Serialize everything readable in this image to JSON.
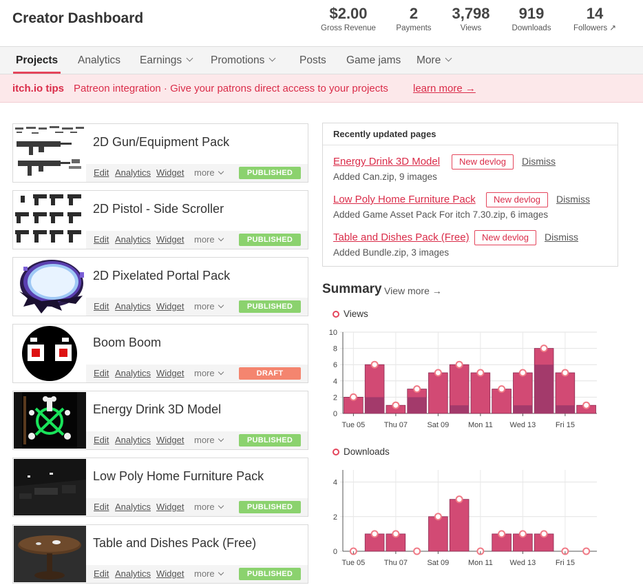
{
  "header": {
    "title": "Creator Dashboard",
    "stats": [
      {
        "value": "$2.00",
        "label": "Gross Revenue"
      },
      {
        "value": "2",
        "label": "Payments"
      },
      {
        "value": "3,798",
        "label": "Views"
      },
      {
        "value": "919",
        "label": "Downloads"
      },
      {
        "value": "14",
        "label": "Followers ↗"
      }
    ]
  },
  "nav": {
    "projects": "Projects",
    "analytics": "Analytics",
    "earnings": "Earnings",
    "promotions": "Promotions",
    "posts": "Posts",
    "game_jams": "Game jams",
    "more": "More"
  },
  "tips": {
    "label": "itch.io tips",
    "text": "Patreon integration · Give your patrons direct access to your projects",
    "link": "learn more →"
  },
  "project_actions": {
    "edit": "Edit",
    "analytics": "Analytics",
    "widget": "Widget",
    "more": "more"
  },
  "projects": [
    {
      "name": "2D Gun/Equipment Pack",
      "status": "PUBLISHED"
    },
    {
      "name": "2D Pistol - Side Scroller",
      "status": "PUBLISHED"
    },
    {
      "name": "2D Pixelated Portal Pack",
      "status": "PUBLISHED"
    },
    {
      "name": "Boom Boom",
      "status": "DRAFT"
    },
    {
      "name": "Energy Drink 3D Model",
      "status": "PUBLISHED"
    },
    {
      "name": "Low Poly Home Furniture Pack",
      "status": "PUBLISHED"
    },
    {
      "name": "Table and Dishes Pack (Free)",
      "status": "PUBLISHED"
    }
  ],
  "recent": {
    "heading": "Recently updated pages",
    "new_devlog": "New devlog",
    "dismiss": "Dismiss",
    "items": [
      {
        "title": "Energy Drink 3D Model",
        "desc": "Added Can.zip, 9 images"
      },
      {
        "title": "Low Poly Home Furniture Pack",
        "desc": "Added Game Asset Pack For itch 7.30.zip, 6 images"
      },
      {
        "title": "Table and Dishes Pack (Free)",
        "desc": "Added Bundle.zip, 3 images"
      }
    ]
  },
  "summary": {
    "title": "Summary",
    "view_more": "View more →"
  },
  "colors": {
    "accent": "#da2c49",
    "bar": "#d24a74",
    "bar_dark": "#a33a6b",
    "published": "#8bd26e",
    "draft": "#f4856f"
  },
  "chart_data": [
    {
      "type": "bar",
      "title": "Views",
      "x": [
        "Tue 05",
        "Wed 06",
        "Thu 07",
        "Fri 08",
        "Sat 09",
        "Sun 10",
        "Mon 11",
        "Tue 12",
        "Wed 13",
        "Thu 14",
        "Fri 15",
        "Sat 16"
      ],
      "tick_labels": [
        "Tue 05",
        "Thu 07",
        "Sat 09",
        "Mon 11",
        "Wed 13",
        "Fri 15"
      ],
      "values": [
        2,
        6,
        1,
        3,
        5,
        6,
        5,
        3,
        5,
        8,
        5,
        1
      ],
      "dark_segment": [
        0,
        2,
        0,
        2,
        0,
        1,
        0,
        0,
        1,
        6,
        1,
        0
      ],
      "ylim": [
        0,
        10
      ],
      "yticks": [
        0,
        2,
        4,
        6,
        8,
        10
      ],
      "grid": true
    },
    {
      "type": "bar",
      "title": "Downloads",
      "x": [
        "Tue 05",
        "Wed 06",
        "Thu 07",
        "Fri 08",
        "Sat 09",
        "Sun 10",
        "Mon 11",
        "Tue 12",
        "Wed 13",
        "Thu 14",
        "Fri 15",
        "Sat 16"
      ],
      "tick_labels": [
        "Tue 05",
        "Thu 07",
        "Sat 09",
        "Mon 11",
        "Wed 13",
        "Fri 15"
      ],
      "values": [
        0,
        1,
        1,
        0,
        2,
        3,
        0,
        1,
        1,
        1,
        0,
        0
      ],
      "ylim": [
        0,
        4.7
      ],
      "yticks": [
        0,
        2,
        4
      ],
      "grid": true
    }
  ]
}
